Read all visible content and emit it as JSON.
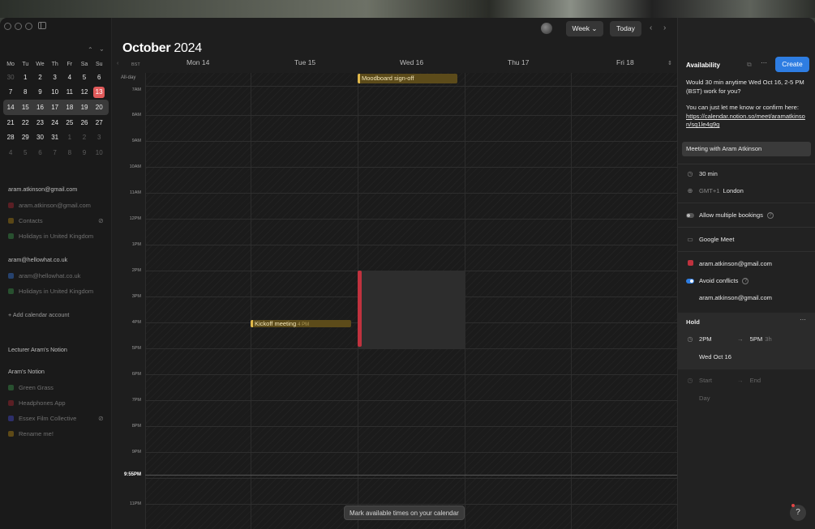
{
  "header": {
    "month": "October",
    "year": "2024",
    "view": "Week",
    "today_label": "Today"
  },
  "mini_calendar": {
    "weekdays": [
      "Mo",
      "Tu",
      "We",
      "Th",
      "Fr",
      "Sa",
      "Su"
    ],
    "weeks": [
      [
        "30",
        "1",
        "2",
        "3",
        "4",
        "5",
        "6"
      ],
      [
        "7",
        "8",
        "9",
        "10",
        "11",
        "12",
        "13"
      ],
      [
        "14",
        "15",
        "16",
        "17",
        "18",
        "19",
        "20"
      ],
      [
        "21",
        "22",
        "23",
        "24",
        "25",
        "26",
        "27"
      ],
      [
        "28",
        "29",
        "30",
        "31",
        "1",
        "2",
        "3"
      ],
      [
        "4",
        "5",
        "6",
        "7",
        "8",
        "9",
        "10"
      ]
    ],
    "today": "13"
  },
  "sidebar": {
    "account1": "aram.atkinson@gmail.com",
    "account1_cals": [
      "aram.atkinson@gmail.com",
      "Contacts",
      "Holidays in United Kingdom"
    ],
    "account2": "aram@hellowhat.co.uk",
    "account2_cals": [
      "aram@hellowhat.co.uk",
      "Holidays in United Kingdom"
    ],
    "add_account": "Add calendar account",
    "notion1": "Lecturer Aram's Notion",
    "notion2": "Aram's Notion",
    "notion_cals": [
      "Green Grass",
      "Headphones App",
      "Essex Film Collective",
      "Rename me!"
    ],
    "colors": {
      "gmail": "#c0323e",
      "contacts": "#8a6d1d",
      "holidays": "#3f8a52",
      "hellowhat": "#3a6db8",
      "green_grass": "#3f8a52",
      "headphones": "#c0323e",
      "essex": "#4a4fb3",
      "rename": "#b8902a"
    }
  },
  "week": {
    "timezone": "BST",
    "allday_label": "All-day",
    "days": [
      "Mon 14",
      "Tue 15",
      "Wed 16",
      "Thu 17",
      "Fri 18"
    ],
    "times": [
      "7AM",
      "8AM",
      "9AM",
      "10AM",
      "11AM",
      "12PM",
      "1PM",
      "2PM",
      "3PM",
      "4PM",
      "5PM",
      "6PM",
      "7PM",
      "8PM",
      "9PM",
      "11PM"
    ],
    "now_label": "9:55PM",
    "allday_event": "Moodboard sign-off",
    "event": {
      "title": "Kickoff meeting",
      "time": "4 PM"
    },
    "toast": "Mark available times on your calendar"
  },
  "panel": {
    "title": "Availability",
    "create_label": "Create",
    "message": "Would 30 min anytime Wed Oct 16, 2-5 PM (BST) work for you?",
    "message2": "You can just let me know or confirm here:",
    "link": "https://calendar.notion.so/meet/aramatkinson/sq1le4g9g",
    "meeting_name": "Meeting with Aram Atkinson",
    "duration": "30 min",
    "tz_offset": "GMT+1",
    "tz_city": "London",
    "allow_multiple": "Allow multiple bookings",
    "conferencing": "Google Meet",
    "calendar": "aram.atkinson@gmail.com",
    "avoid_conflicts": "Avoid conflicts",
    "conflict_calendar": "aram.atkinson@gmail.com",
    "hold_title": "Hold",
    "hold_start": "2PM",
    "hold_end": "5PM",
    "hold_len": "3h",
    "hold_date": "Wed Oct 16",
    "start_placeholder": "Start",
    "end_placeholder": "End",
    "day_placeholder": "Day",
    "help": "?"
  }
}
